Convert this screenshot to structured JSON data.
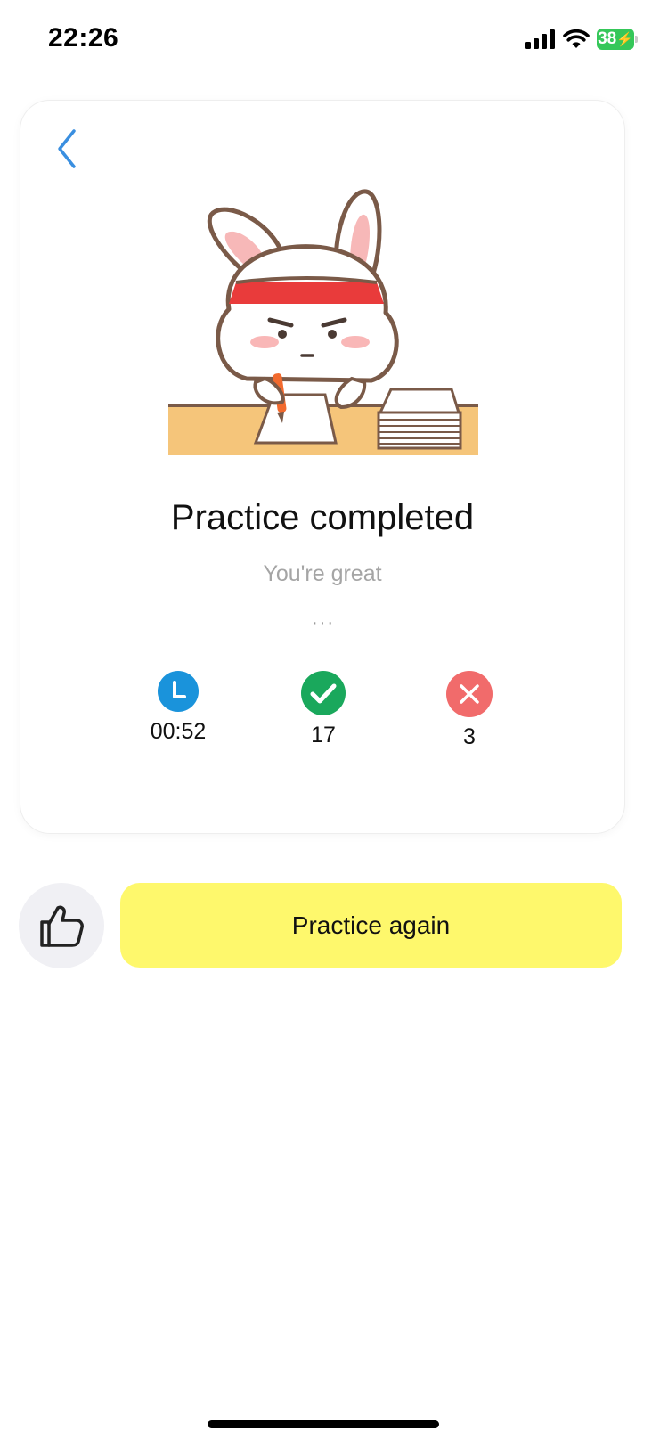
{
  "status_bar": {
    "time": "22:26",
    "battery_level": "38",
    "battery_color": "#35c759"
  },
  "card": {
    "back_icon": "chevron-left-icon",
    "illustration": "rabbit-writing-at-desk",
    "title": "Practice completed",
    "subtitle": "You're great",
    "divider_text": "···",
    "stats": [
      {
        "icon": "clock-icon",
        "value": "00:52",
        "color": "#1a93db"
      },
      {
        "icon": "check-icon",
        "value": "17",
        "color": "#1aa85c"
      },
      {
        "icon": "cross-icon",
        "value": "3",
        "color": "#f16b6b"
      }
    ]
  },
  "actions": {
    "like_icon": "thumbs-up-icon",
    "practice_again_label": "Practice again",
    "practice_again_color": "#fef86c"
  }
}
